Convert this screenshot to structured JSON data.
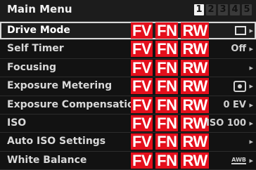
{
  "header": {
    "title": "Main Menu",
    "pages": [
      "1",
      "2",
      "3",
      "4",
      "5"
    ],
    "active_page": "1"
  },
  "badges": {
    "fv": "FV",
    "fn": "FN",
    "rw": "RW"
  },
  "rows": [
    {
      "label": "Drive Mode",
      "value": "",
      "icon": "single-frame-icon",
      "selected": true
    },
    {
      "label": "Self Timer",
      "value": "Off",
      "icon": "",
      "selected": false
    },
    {
      "label": "Focusing",
      "value": "",
      "icon": "",
      "selected": false
    },
    {
      "label": "Exposure Metering",
      "value": "",
      "icon": "metering-icon",
      "selected": false
    },
    {
      "label": "Exposure Compensation",
      "value": "0 EV",
      "icon": "",
      "selected": false
    },
    {
      "label": "ISO",
      "value": "ISO 100",
      "icon": "",
      "selected": false
    },
    {
      "label": "Auto ISO Settings",
      "value": "",
      "icon": "",
      "selected": false
    },
    {
      "label": "White Balance",
      "value": "AWB",
      "icon": "awb-icon",
      "selected": false
    }
  ],
  "colors": {
    "badge": "#e40f1c",
    "background": "#121212",
    "text": "#d8d8d8"
  }
}
